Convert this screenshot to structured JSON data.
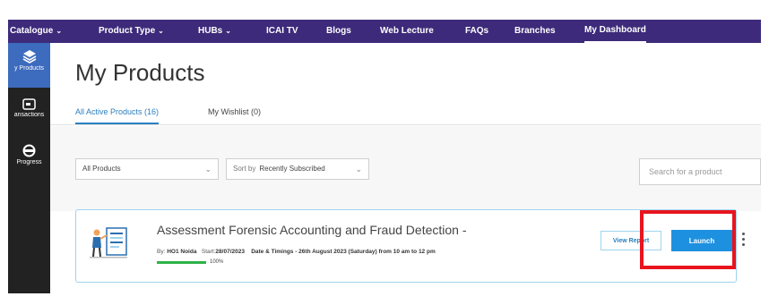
{
  "nav": {
    "items": [
      {
        "label": "Catalogue",
        "caret": "⌄"
      },
      {
        "label": "Product Type",
        "caret": "⌄"
      },
      {
        "label": "HUBs",
        "caret": "⌄"
      },
      {
        "label": "ICAI TV",
        "caret": ""
      },
      {
        "label": "Blogs",
        "caret": ""
      },
      {
        "label": "Web Lecture",
        "caret": ""
      },
      {
        "label": "FAQs",
        "caret": ""
      },
      {
        "label": "Branches",
        "caret": ""
      },
      {
        "label": "My Dashboard",
        "caret": ""
      }
    ],
    "active": "My Dashboard"
  },
  "sidebar": {
    "items": [
      {
        "label": "y Products",
        "icon": "layers-icon",
        "active": true
      },
      {
        "label": "ansactions",
        "icon": "receipt-icon",
        "active": false
      },
      {
        "label": "Progress",
        "icon": "progress-icon",
        "active": false
      }
    ]
  },
  "main": {
    "title": "My Products",
    "tabs": [
      {
        "label": "All Active Products (16)",
        "active": true
      },
      {
        "label": "My Wishlist (0)",
        "active": false
      }
    ]
  },
  "filters": {
    "product_filter": "All Products",
    "sort_label": "Sort by",
    "sort_value": "Recently Subscribed",
    "search_placeholder": "Search for a product"
  },
  "product": {
    "title": "Assessment Forensic Accounting and Fraud Detection -",
    "by_label": "By:",
    "by_value": "HO1 Noida",
    "start_label": "Start:",
    "start_value": "28/07/2023",
    "schedule": "Date & Timings - 26th August 2023 (Saturday) from 10 am to 12 pm",
    "progress_text": "100%",
    "progress_fraction": 1.0,
    "view_report_label": "View Report",
    "launch_label": "Launch"
  },
  "colors": {
    "nav_bg": "#3d2a7a",
    "sidebar_bg": "#222222",
    "accent": "#1e90e0",
    "highlight": "#e8141e",
    "progress": "#2fb24a"
  }
}
